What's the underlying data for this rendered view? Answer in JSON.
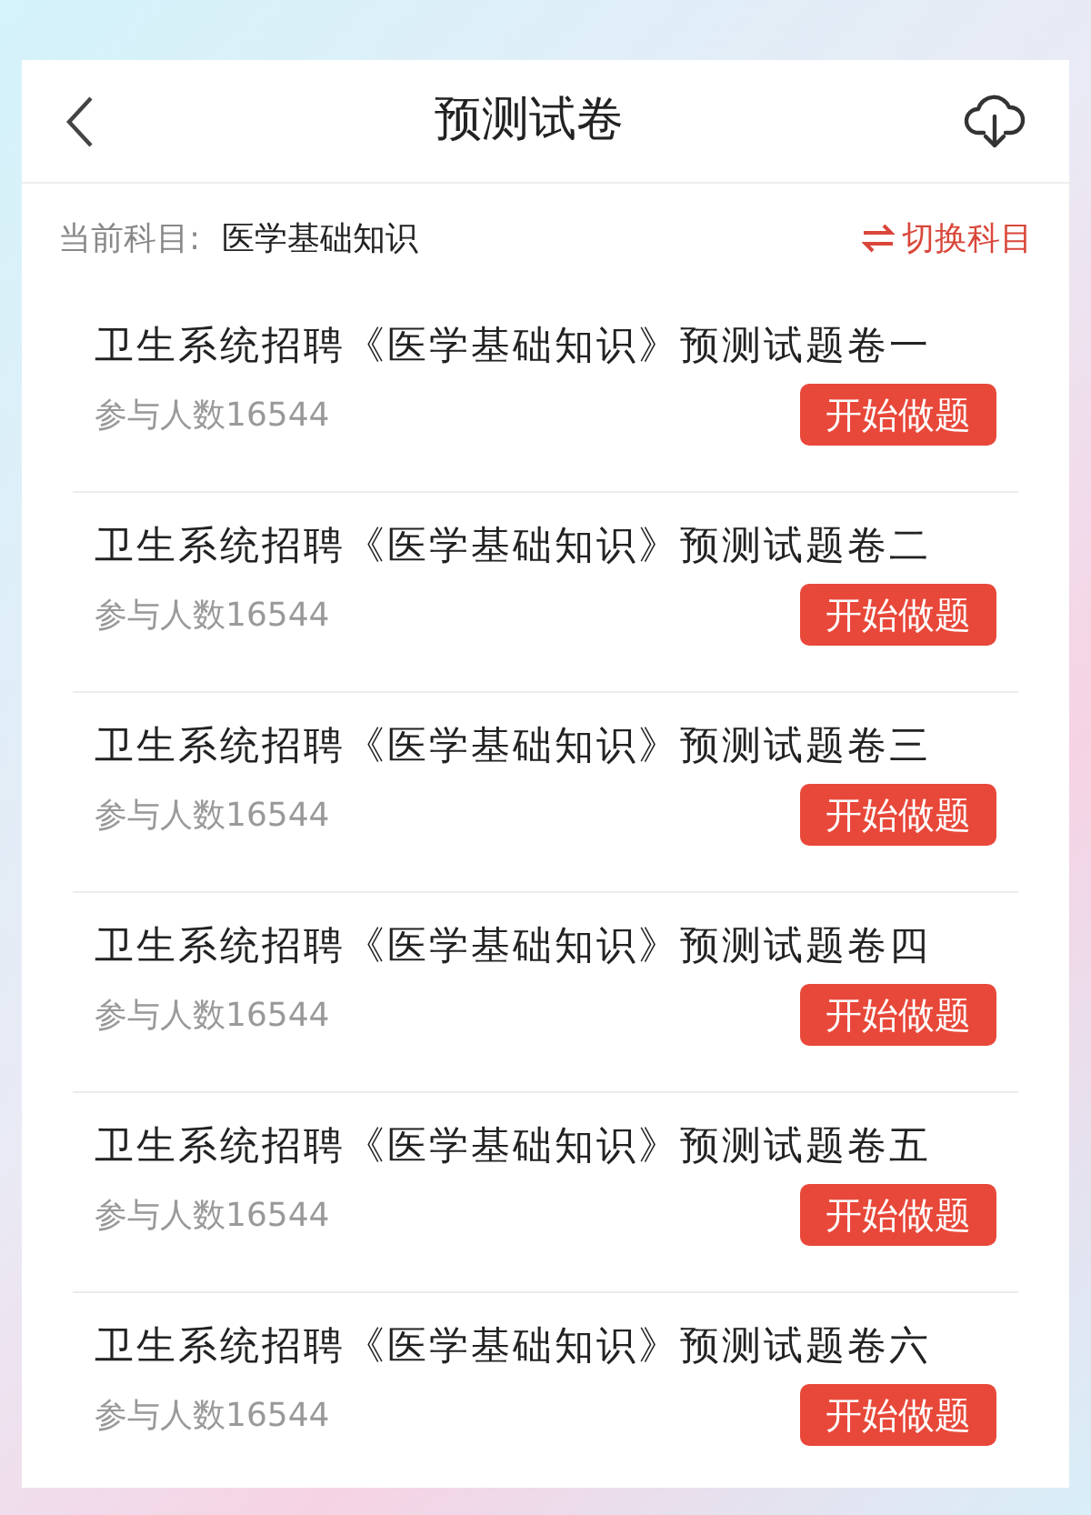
{
  "header": {
    "title": "预测试卷"
  },
  "subject": {
    "label": "当前科目:",
    "value": "医学基础知识",
    "switch": "切换科目"
  },
  "papers": [
    {
      "title": "卫生系统招聘《医学基础知识》预测试题卷一",
      "participants": "参与人数16544",
      "action": "开始做题"
    },
    {
      "title": "卫生系统招聘《医学基础知识》预测试题卷二",
      "participants": "参与人数16544",
      "action": "开始做题"
    },
    {
      "title": "卫生系统招聘《医学基础知识》预测试题卷三",
      "participants": "参与人数16544",
      "action": "开始做题"
    },
    {
      "title": "卫生系统招聘《医学基础知识》预测试题卷四",
      "participants": "参与人数16544",
      "action": "开始做题"
    },
    {
      "title": "卫生系统招聘《医学基础知识》预测试题卷五",
      "participants": "参与人数16544",
      "action": "开始做题"
    },
    {
      "title": "卫生系统招聘《医学基础知识》预测试题卷六",
      "participants": "参与人数16544",
      "action": "开始做题"
    }
  ]
}
